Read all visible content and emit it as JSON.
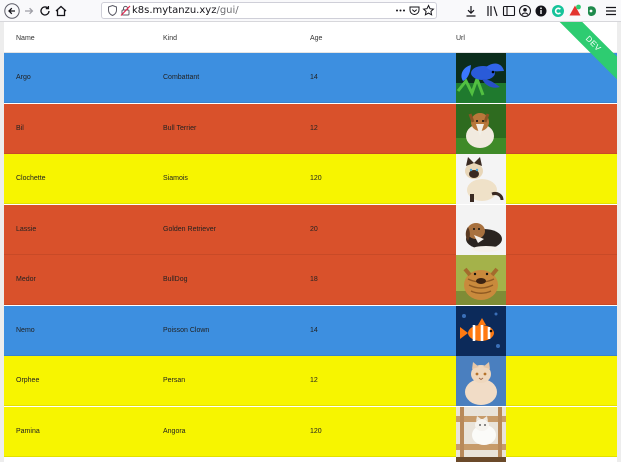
{
  "browser": {
    "url_host": "k8s.mytanzu.xyz",
    "url_path": "/gui/",
    "toolbar_icons": [
      "back-icon",
      "forward-icon",
      "reload-icon",
      "home-icon"
    ],
    "right_icons": [
      "library-icon",
      "sidebar-icon",
      "account-icon",
      "info-icon",
      "extension-c-icon",
      "extension-red-icon",
      "extension-green-icon",
      "menu-icon"
    ]
  },
  "table": {
    "headers": {
      "name": "Name",
      "kind": "Kind",
      "age": "Age",
      "url": "Url"
    },
    "rows": [
      {
        "name": "Argo",
        "kind": "Combattant",
        "age": "14",
        "color": "#3d8fe0",
        "image": "fish-betta"
      },
      {
        "name": "Bil",
        "kind": "Bull Terrier",
        "age": "12",
        "color": "#d9512b",
        "image": "dog-collie"
      },
      {
        "name": "Clochette",
        "kind": "Siamois",
        "age": "120",
        "color": "#f7f500",
        "image": "cat-siamese"
      },
      {
        "name": "Lassie",
        "kind": "Golden Retriever",
        "age": "20",
        "color": "#d9512b",
        "image": "dog-beagle"
      },
      {
        "name": "Medor",
        "kind": "BullDog",
        "age": "18",
        "color": "#d9512b",
        "image": "dog-sharpei"
      },
      {
        "name": "Nemo",
        "kind": "Poisson Clown",
        "age": "14",
        "color": "#3d8fe0",
        "image": "fish-clown"
      },
      {
        "name": "Orphee",
        "kind": "Persan",
        "age": "12",
        "color": "#f7f500",
        "image": "cat-persian"
      },
      {
        "name": "Pamina",
        "kind": "Angora",
        "age": "120",
        "color": "#f7f500",
        "image": "cat-angora"
      }
    ]
  },
  "ribbon": {
    "label": "DEV",
    "color": "#2ecc71"
  }
}
